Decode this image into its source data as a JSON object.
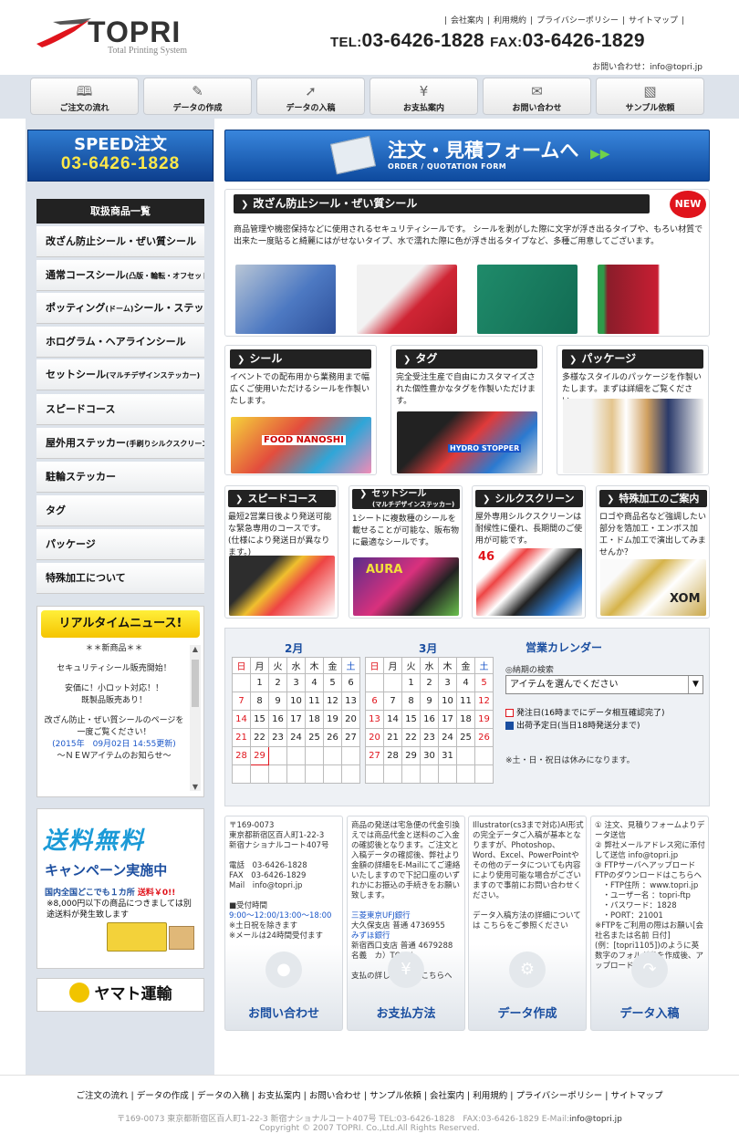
{
  "header": {
    "logo": "TOPRI",
    "logo_sub": "Total Printing System",
    "links": [
      "会社案内",
      "利用規約",
      "プライバシーポリシー",
      "サイトマップ"
    ],
    "tel_label": "TEL:",
    "tel": "03-6426-1828",
    "fax_label": "FAX:",
    "fax": "03-6426-1829",
    "contact": "お問い合わせ：info@topri.jp"
  },
  "nav": [
    {
      "label": "ご注文の流れ",
      "icon": "book-icon"
    },
    {
      "label": "データの作成",
      "icon": "document-pencil-icon"
    },
    {
      "label": "データの入稿",
      "icon": "upload-arrow-icon"
    },
    {
      "label": "お支払案内",
      "icon": "yen-coin-icon"
    },
    {
      "label": "お問い合わせ",
      "icon": "envelope-icon"
    },
    {
      "label": "サンプル依頼",
      "icon": "bag-icon"
    }
  ],
  "speed": {
    "title": "SPEED注文",
    "tel": "03-6426-1828"
  },
  "order": {
    "title": "注文・見積フォームへ",
    "sub": "ORDER / QUOTATION FORM"
  },
  "sidebar": {
    "heading": "取扱商品一覧",
    "items": [
      {
        "label": "改ざん防止シール・ぜい質シール",
        "small": ""
      },
      {
        "label": "通常コースシール",
        "small": "(凸版・輪転・オフセット)"
      },
      {
        "label": "ポッティング",
        "small": "(ドーム)",
        "label2": "シール・ステッカー"
      },
      {
        "label": "ホログラム・ヘアラインシール",
        "small": ""
      },
      {
        "label": "セットシール",
        "small": "(マルチデザインステッカー)"
      },
      {
        "label": "スピードコース",
        "small": ""
      },
      {
        "label": "屋外用ステッカー",
        "small": "(手刷りシルクスクリーン)"
      },
      {
        "label": "駐輪ステッカー",
        "small": ""
      },
      {
        "label": "タグ",
        "small": ""
      },
      {
        "label": "パッケージ",
        "small": ""
      },
      {
        "label": "特殊加工について",
        "small": ""
      }
    ]
  },
  "news": {
    "heading": "リアルタイムニュース!",
    "items": [
      "＊＊新商品＊＊",
      "セキュリティシール販売開始！",
      "安価に！小ロット対応！！",
      "既製品販売あり！",
      "改ざん防止・ぜい質シールのページを",
      "一度ご覧ください！",
      "(2015年　09月02日 14:55更新)",
      "～ＮＥＷアイテムのお知らせ～"
    ]
  },
  "freeship": {
    "t1": "送料無料",
    "t2": "キャンペーン実施中",
    "t3a": "国内全国どこでも１カ所",
    "t3b": "送料￥0!!",
    "t4": "※8,000円以下の商品につきましては別途送料が発生致します"
  },
  "yamato": "ヤマト運輸",
  "featured": {
    "title": "改ざん防止シール・ぜい質シール",
    "badge": "NEW",
    "desc": "商品管理や機密保持などに使用されるセキュリティシールです。 シールを剥がした際に文字が浮き出るタイプや、もろい材質で出来た一度貼ると綺麗にはがせないタイプ、水で濡れた際に色が浮き出るタイプなど、多種ご用意してございます。"
  },
  "row1": [
    {
      "title": "シール",
      "desc": "イベントでの配布用から業務用まで幅広くご使用いただけるシールを作製いたします。",
      "img_text": "FOOD NANOSHI"
    },
    {
      "title": "タグ",
      "desc": "完全受注生産で自由にカスタマイズされた個性豊かなタグを作製いただけます。",
      "img_text": "HYDRO STOPPER"
    },
    {
      "title": "パッケージ",
      "desc": "多様なスタイルのパッケージを作製いたします。まずは詳細をご覧ください。",
      "img_text": ""
    }
  ],
  "row2": [
    {
      "title": "スピードコース",
      "sub": "",
      "desc": "最短2営業日後より発送可能な緊急専用のコースです。(仕様により発送日が異なります。)",
      "img_text": ""
    },
    {
      "title": "セットシール",
      "sub": "(マルチデザインステッカー)",
      "desc": "1シートに複数種のシールを載せることが可能な、販布物に最適なシールです。",
      "img_text": "AURA"
    },
    {
      "title": "シルクスクリーン",
      "sub": "",
      "desc": "屋外専用シルクスクリーンは耐候性に優れ、長期間のご使用が可能です。",
      "img_text": "46"
    },
    {
      "title": "特殊加工のご案内",
      "sub": "",
      "desc": "ロゴや商品名など強調したい部分を箔加工・エンボス加工・ドム加工で演出してみませんか？",
      "img_text": "XOM"
    }
  ],
  "calendar": {
    "months": [
      {
        "title": "2月",
        "weekdays": [
          "日",
          "月",
          "火",
          "水",
          "木",
          "金",
          "土"
        ],
        "rows": [
          [
            "",
            "",
            "",
            "",
            "",
            "",
            ""
          ],
          [
            "",
            "1",
            "2",
            "3",
            "4",
            "5",
            "6"
          ],
          [
            "7",
            "8",
            "9",
            "10",
            "11",
            "12",
            "13"
          ],
          [
            "14",
            "15",
            "16",
            "17",
            "18",
            "19",
            "20"
          ],
          [
            "21",
            "22",
            "23",
            "24",
            "25",
            "26",
            "27"
          ],
          [
            "28",
            "29",
            "",
            "",
            "",
            "",
            ""
          ],
          [
            "",
            "",
            "",
            "",
            "",
            "",
            ""
          ]
        ]
      },
      {
        "title": "3月",
        "weekdays": [
          "日",
          "月",
          "火",
          "水",
          "木",
          "金",
          "土"
        ],
        "rows": [
          [
            "",
            "",
            "",
            "",
            "",
            "",
            ""
          ],
          [
            "",
            "",
            "1",
            "2",
            "3",
            "4",
            "5"
          ],
          [
            "6",
            "7",
            "8",
            "9",
            "10",
            "11",
            "12"
          ],
          [
            "13",
            "14",
            "15",
            "16",
            "17",
            "18",
            "19"
          ],
          [
            "20",
            "21",
            "22",
            "23",
            "24",
            "25",
            "26"
          ],
          [
            "27",
            "28",
            "29",
            "30",
            "31",
            "",
            ""
          ],
          [
            "",
            "",
            "",
            "",
            "",
            "",
            ""
          ]
        ]
      }
    ],
    "heading": "営業カレンダー",
    "nouki": "◎納期の検索",
    "select": "アイテムを選んでください",
    "legend1": "発注日(16時までにデータ相互確認完了)",
    "legend2": "出荷予定日(当日18時発送分まで)",
    "note": "※土・日・祝日は休みになります。",
    "colors": {
      "order": "#e0141c",
      "ship": "#1a4ea0"
    }
  },
  "info": [
    {
      "text": "〒169-0073\n東京都新宿区百人町1-22-3\n新宿ナショナルコート407号\n\n電話　03-6426-1828\nFAX　03-6426-1829\nMail　info@topri.jp\n\n■受付時間",
      "blue": "9:00～12:00/13:00～18:00",
      "text2": "※土日祝を除きます\n※メールは24時間受付ます",
      "button": "お問い合わせ",
      "icon": "speech-bubble-icon"
    },
    {
      "text": "商品の発送は宅急便の代金引換えでは商品代金と送料のご入金の確認後となります。ご注文と入稿データの確認後、弊社より金額の詳細をE-Mailにてご連絡いたしますので下記口座のいずれかにお振込の手続きをお願い致します。",
      "blue": "三菱東京UFJ銀行",
      "text2": "大久保支店 普通 4736955",
      "blue2": "みずほ銀行",
      "text3": "新宿西口支店 普通 4679288\n名義　カ）TOPRI\n\n支払の詳しい情報はこちらへ",
      "button": "お支払方法",
      "icon": "yen-icon"
    },
    {
      "text": "Illustrator(cs3まで対応)AI形式の完全データご入稿が基本となりますが、Photoshop、Word、Excel、PowerPointやその他のデータについても内容により使用可能な場合がございますので事前にお問い合わせください。\n\nデータ入稿方法の詳細については こちらをご参照ください",
      "button": "データ作成",
      "icon": "gear-icon"
    },
    {
      "text": "① 注文、見積りフォームよりデータ送信\n② 弊社メールアドレス宛に添付して送信 info@topri.jp\n③ FTPサーバへアップロード\nFTPのダウンロードはこちらへ\n　・FTP住所 ：www.topri.jp\n　・ユーザー名 ：topri-ftp\n　・パスワード：1828\n　・PORT：21001\n※FTPをご利用の際はお願い[会社名または名前 日付]\n(例：[topri1105])のように英数字のフォルダ名を作成後、アップロード下さい",
      "button": "データ入稿",
      "icon": "share-arrow-icon"
    }
  ],
  "footer": {
    "links": [
      "ご注文の流れ",
      "データの作成",
      "データの入稿",
      "お支払案内",
      "お問い合わせ",
      "サンプル依頼",
      "会社案内",
      "利用規約",
      "プライバシーポリシー",
      "サイトマップ"
    ],
    "address": "〒169-0073 東京都新宿区百人町1-22-3 新宿ナショナルコート407号 TEL:03-6426-1828　FAX:03-6426-1829 E-Mail:",
    "email": "info@topri.jp",
    "copyright": "Copyright © 2007 TOPRI. Co.,Ltd.All Rights Reserved."
  }
}
